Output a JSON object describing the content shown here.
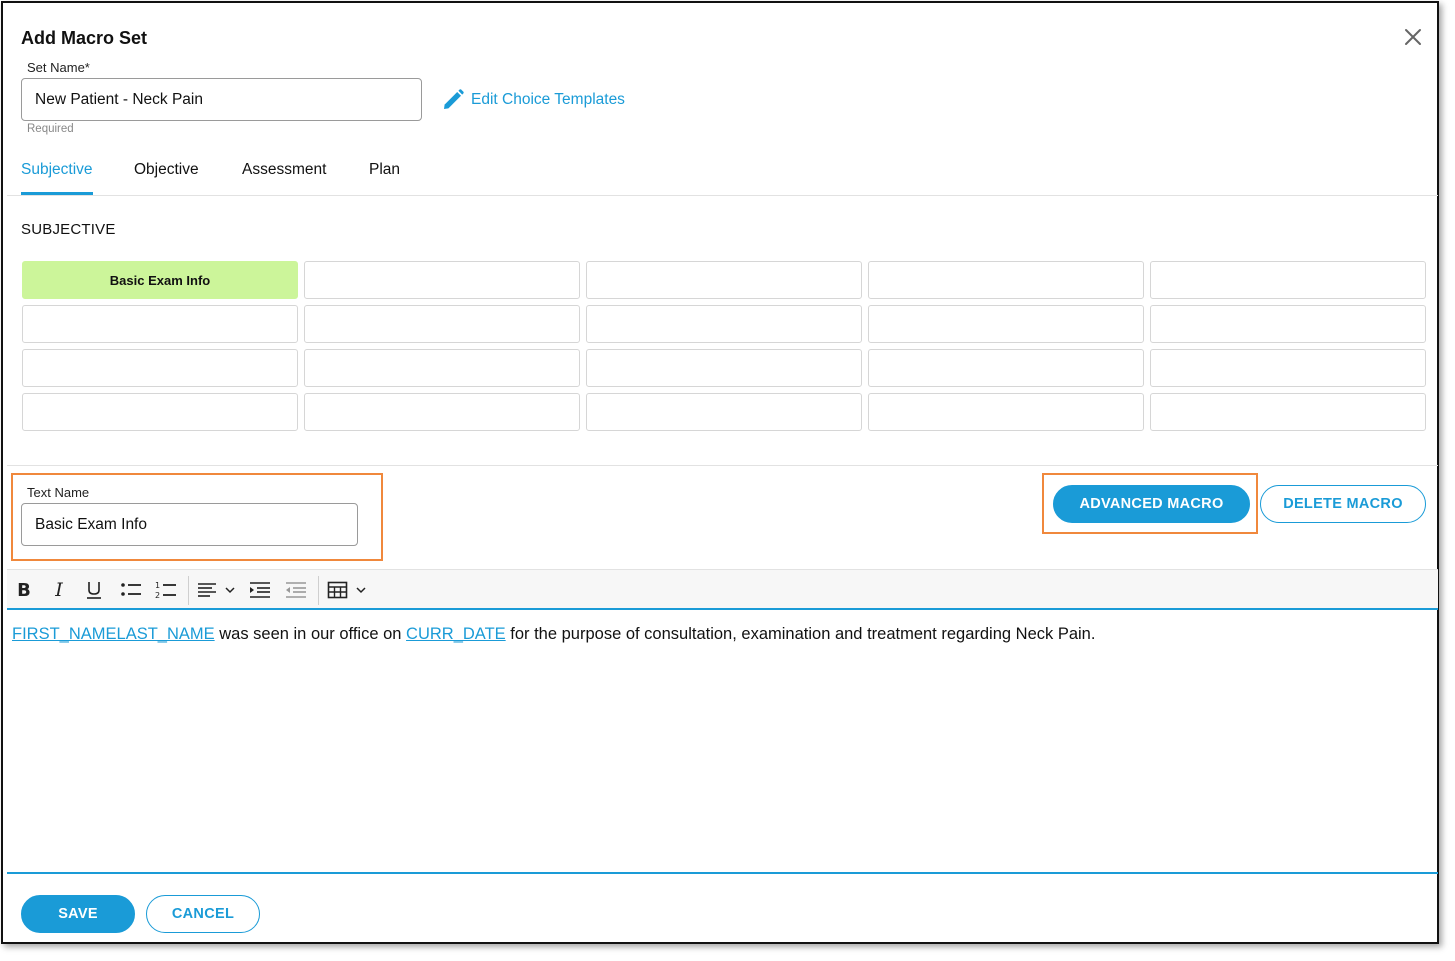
{
  "dialog": {
    "title": "Add Macro Set",
    "close_icon": "close-icon"
  },
  "set_name": {
    "label": "Set Name*",
    "value": "New Patient - Neck Pain",
    "helper": "Required"
  },
  "edit_choice_templates": {
    "label": "Edit Choice Templates",
    "icon": "pencil-icon"
  },
  "tabs": [
    {
      "label": "Subjective",
      "active": true
    },
    {
      "label": "Objective",
      "active": false
    },
    {
      "label": "Assessment",
      "active": false
    },
    {
      "label": "Plan",
      "active": false
    }
  ],
  "section": {
    "title": "SUBJECTIVE"
  },
  "macro_grid": {
    "rows": [
      [
        "Basic Exam Info",
        "",
        "",
        "",
        ""
      ],
      [
        "",
        "",
        "",
        "",
        ""
      ],
      [
        "",
        "",
        "",
        "",
        ""
      ],
      [
        "",
        "",
        "",
        "",
        ""
      ]
    ],
    "active_cell": [
      0,
      0
    ],
    "active_color": "#ccf59a"
  },
  "text_name": {
    "label": "Text Name",
    "value": "Basic Exam Info"
  },
  "actions": {
    "advanced_macro": "ADVANCED MACRO",
    "delete_macro": "DELETE MACRO"
  },
  "toolbar": {
    "buttons": [
      "bold-icon",
      "italic-icon",
      "underline-icon",
      "bullet-list-icon",
      "numbered-list-icon",
      "align-left-icon",
      "indent-icon",
      "outdent-icon",
      "table-icon"
    ]
  },
  "editor": {
    "token_first_name": "FIRST_NAME",
    "token_last_name": "LAST_NAME",
    "text_seen": " was seen in our office on ",
    "token_curr_date": "CURR_DATE",
    "text_purpose": " for the purpose of consultation, examination and treatment regarding Neck Pain."
  },
  "footer": {
    "save": "SAVE",
    "cancel": "CANCEL"
  },
  "colors": {
    "accent": "#1a9bd7",
    "highlight": "#f0883c",
    "active_cell": "#ccf59a"
  }
}
